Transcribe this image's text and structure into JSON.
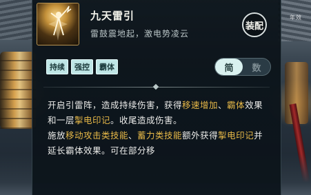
{
  "skill": {
    "name": "九天雷引",
    "subtitle": "雷鼓震地起，激电势凌云",
    "equip_label": "装配",
    "icon": "lightning-caster-icon"
  },
  "tags": [
    "持续",
    "强控",
    "霸体"
  ],
  "toggle": {
    "simple": "简",
    "detailed": "数",
    "selected": "simple"
  },
  "description": {
    "p1": [
      {
        "text": "开启引雷阵，造成持续伤害，获得"
      },
      {
        "text": "移速增加",
        "kw": true
      },
      {
        "text": "、"
      },
      {
        "text": "霸体",
        "kw": true
      },
      {
        "text": "效果和一层"
      },
      {
        "text": "掣电印记",
        "kw": true
      },
      {
        "text": "。收尾造成伤害。"
      }
    ],
    "p2": [
      {
        "text": "施放"
      },
      {
        "text": "移动攻击类技能",
        "kw": true
      },
      {
        "text": "、"
      },
      {
        "text": "蓄力类技能",
        "kw": true
      },
      {
        "text": "额外获得"
      },
      {
        "text": "掣电印记",
        "kw": true
      },
      {
        "text": "并延长霸体效果。可在部分移"
      }
    ]
  },
  "background": {
    "side_text": "年效"
  },
  "colors": {
    "keyword": "#e8b948",
    "tag_bg": "#bfe6e6",
    "panel_bg": "#0c141b"
  }
}
